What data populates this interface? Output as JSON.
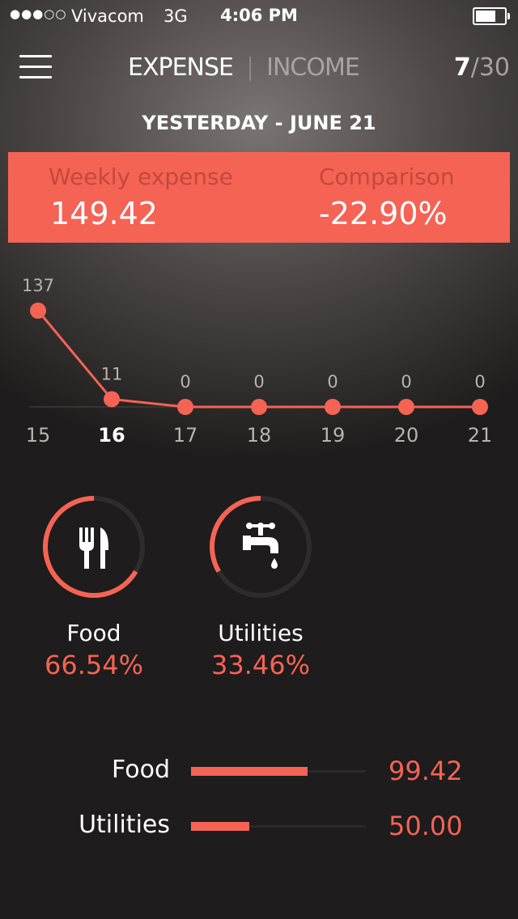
{
  "status_bar": {
    "signal": "●●●○○",
    "carrier": "Vivacom",
    "network": "3G",
    "time": "4:06 PM",
    "battery_level": 0.7
  },
  "nav": {
    "menu_icon": "hamburger-menu-icon",
    "tab_expense": "EXPENSE",
    "separator": "|",
    "tab_income": "INCOME",
    "active_tab": "EXPENSE",
    "page_current": "7",
    "page_total": "/30"
  },
  "date_title": "YESTERDAY - JUNE 21",
  "summary": {
    "weekly_label": "Weekly expense",
    "weekly_value": "149.42",
    "comparison_label": "Comparison",
    "comparison_value": "-22.90%"
  },
  "chart_data": {
    "type": "line",
    "x": [
      "15",
      "16",
      "17",
      "18",
      "19",
      "20",
      "21"
    ],
    "values": [
      137,
      11,
      0,
      0,
      0,
      0,
      0
    ],
    "data_labels": [
      "137",
      "11",
      "0",
      "0",
      "0",
      "0",
      "0"
    ],
    "highlighted_x": "16",
    "color": "#f56355"
  },
  "categories": [
    {
      "name": "Food",
      "percent": "66.54%",
      "fraction": 0.6654,
      "icon": "fork-knife-icon"
    },
    {
      "name": "Utilities",
      "percent": "33.46%",
      "fraction": 0.3346,
      "icon": "water-tap-icon"
    }
  ],
  "breakdown": [
    {
      "name": "Food",
      "value": "99.42",
      "fraction": 0.6654
    },
    {
      "name": "Utilities",
      "value": "50.00",
      "fraction": 0.3346
    }
  ],
  "colors": {
    "accent": "#f56355",
    "accent_dark_text": "#c4483c",
    "ring_track": "#2e2d2d"
  }
}
